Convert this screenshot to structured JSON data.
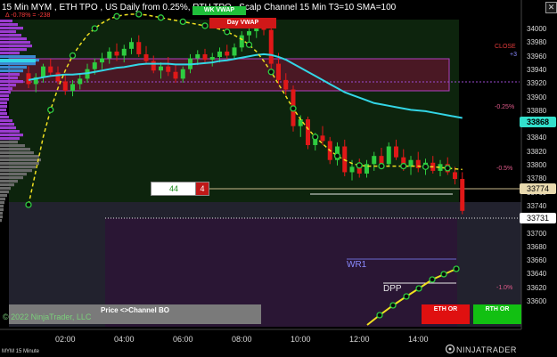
{
  "header": {
    "title": "15 Min MYM , ETH TPO , US Daily from 0.25%, RTH TPO , Scalp Channel 15 Min  T3=10 SMA=100",
    "subtitle": "Δ -0.78% = -238",
    "close_icon": "close-x-icon"
  },
  "tags": {
    "wk_vwap": "WK VWAP",
    "day_vwap": "Day VWAP",
    "close": "CLOSE",
    "close_sub": "+3"
  },
  "percent_labels": [
    "-0.25%",
    "-0.5%",
    "-1.0%"
  ],
  "price_axis": {
    "ticks": [
      "34000",
      "33980",
      "33960",
      "33940",
      "33920",
      "33900",
      "33880",
      "33860",
      "33840",
      "33820",
      "33800",
      "33780",
      "33760",
      "33740",
      "33720",
      "33700",
      "33680",
      "33660",
      "33640",
      "33620",
      "33600"
    ],
    "highlight_current": "33868",
    "highlight_level": "33774",
    "highlight_last": "33731"
  },
  "time_axis": [
    "02:00",
    "04:00",
    "06:00",
    "08:00",
    "10:00",
    "12:00",
    "14:00"
  ],
  "labels": {
    "wr1": "WR1",
    "dpp": "DPP",
    "price_channel": "Price <>Channel BO",
    "copyright": "© 2022 NinjaTrader, LLC",
    "counter_green": "44",
    "counter_red": "4",
    "eth_button": "ETH OR",
    "rth_button": "RTH OR",
    "brand": "NINJATRADER",
    "bottom_tab": "MYM 15 Minute"
  },
  "colors": {
    "background": "#000000",
    "bull_candle": "#2ecc40",
    "bear_candle": "#e01818",
    "sma_line": "#33d6e6",
    "channel_dots": "#f0e020",
    "pink_zone": "#5a1e2a",
    "grey_zone": "#2a2a3a",
    "purple_zone": "#2a1a34",
    "green_zone": "#0d2a0d"
  },
  "candles": [
    {
      "t": "00:15",
      "o": 33934,
      "h": 33944,
      "l": 33912,
      "c": 33918
    },
    {
      "t": "00:30",
      "o": 33918,
      "h": 33934,
      "l": 33906,
      "c": 33928
    },
    {
      "t": "00:45",
      "o": 33928,
      "h": 33948,
      "l": 33920,
      "c": 33944
    },
    {
      "t": "01:00",
      "o": 33944,
      "h": 33955,
      "l": 33930,
      "c": 33935
    },
    {
      "t": "01:15",
      "o": 33935,
      "h": 33944,
      "l": 33918,
      "c": 33922
    },
    {
      "t": "01:30",
      "o": 33922,
      "h": 33932,
      "l": 33902,
      "c": 33908
    },
    {
      "t": "01:45",
      "o": 33908,
      "h": 33924,
      "l": 33900,
      "c": 33918
    },
    {
      "t": "02:00",
      "o": 33918,
      "h": 33932,
      "l": 33910,
      "c": 33926
    },
    {
      "t": "02:15",
      "o": 33926,
      "h": 33948,
      "l": 33920,
      "c": 33940
    },
    {
      "t": "02:30",
      "o": 33940,
      "h": 33956,
      "l": 33932,
      "c": 33950
    },
    {
      "t": "02:45",
      "o": 33950,
      "h": 33964,
      "l": 33940,
      "c": 33956
    },
    {
      "t": "03:00",
      "o": 33956,
      "h": 33972,
      "l": 33948,
      "c": 33966
    },
    {
      "t": "03:15",
      "o": 33966,
      "h": 33978,
      "l": 33952,
      "c": 33960
    },
    {
      "t": "03:30",
      "o": 33960,
      "h": 33976,
      "l": 33950,
      "c": 33970
    },
    {
      "t": "03:45",
      "o": 33970,
      "h": 33986,
      "l": 33962,
      "c": 33980
    },
    {
      "t": "04:00",
      "o": 33980,
      "h": 33990,
      "l": 33958,
      "c": 33962
    },
    {
      "t": "04:15",
      "o": 33962,
      "h": 33974,
      "l": 33948,
      "c": 33952
    },
    {
      "t": "04:30",
      "o": 33952,
      "h": 33960,
      "l": 33934,
      "c": 33938
    },
    {
      "t": "04:45",
      "o": 33938,
      "h": 33950,
      "l": 33926,
      "c": 33944
    },
    {
      "t": "05:00",
      "o": 33944,
      "h": 33958,
      "l": 33930,
      "c": 33936
    },
    {
      "t": "05:15",
      "o": 33936,
      "h": 33946,
      "l": 33920,
      "c": 33926
    },
    {
      "t": "05:30",
      "o": 33926,
      "h": 33944,
      "l": 33920,
      "c": 33940
    },
    {
      "t": "05:45",
      "o": 33940,
      "h": 33962,
      "l": 33934,
      "c": 33956
    },
    {
      "t": "06:00",
      "o": 33956,
      "h": 33968,
      "l": 33946,
      "c": 33962
    },
    {
      "t": "06:15",
      "o": 33962,
      "h": 33970,
      "l": 33950,
      "c": 33954
    },
    {
      "t": "06:30",
      "o": 33954,
      "h": 33964,
      "l": 33944,
      "c": 33958
    },
    {
      "t": "06:45",
      "o": 33958,
      "h": 33972,
      "l": 33950,
      "c": 33966
    },
    {
      "t": "07:00",
      "o": 33966,
      "h": 33976,
      "l": 33954,
      "c": 33960
    },
    {
      "t": "07:15",
      "o": 33960,
      "h": 33978,
      "l": 33956,
      "c": 33972
    },
    {
      "t": "07:30",
      "o": 33972,
      "h": 33996,
      "l": 33966,
      "c": 33990
    },
    {
      "t": "07:45",
      "o": 33990,
      "h": 34004,
      "l": 33980,
      "c": 33996
    },
    {
      "t": "08:00",
      "o": 33996,
      "h": 34010,
      "l": 33986,
      "c": 34002
    },
    {
      "t": "08:15",
      "o": 34002,
      "h": 34014,
      "l": 33990,
      "c": 33998
    },
    {
      "t": "08:30",
      "o": 33998,
      "h": 34012,
      "l": 33940,
      "c": 33948
    },
    {
      "t": "08:45",
      "o": 33948,
      "h": 33964,
      "l": 33918,
      "c": 33924
    },
    {
      "t": "09:00",
      "o": 33924,
      "h": 33934,
      "l": 33902,
      "c": 33910
    },
    {
      "t": "09:15",
      "o": 33910,
      "h": 33916,
      "l": 33848,
      "c": 33856
    },
    {
      "t": "09:30",
      "o": 33856,
      "h": 33872,
      "l": 33840,
      "c": 33866
    },
    {
      "t": "09:45",
      "o": 33866,
      "h": 33870,
      "l": 33822,
      "c": 33828
    },
    {
      "t": "10:00",
      "o": 33828,
      "h": 33846,
      "l": 33820,
      "c": 33842
    },
    {
      "t": "10:15",
      "o": 33842,
      "h": 33856,
      "l": 33828,
      "c": 33834
    },
    {
      "t": "10:30",
      "o": 33834,
      "h": 33840,
      "l": 33800,
      "c": 33806
    },
    {
      "t": "10:45",
      "o": 33806,
      "h": 33832,
      "l": 33798,
      "c": 33826
    },
    {
      "t": "11:00",
      "o": 33826,
      "h": 33836,
      "l": 33782,
      "c": 33788
    },
    {
      "t": "11:15",
      "o": 33788,
      "h": 33806,
      "l": 33776,
      "c": 33796
    },
    {
      "t": "11:30",
      "o": 33796,
      "h": 33808,
      "l": 33780,
      "c": 33786
    },
    {
      "t": "11:45",
      "o": 33786,
      "h": 33806,
      "l": 33780,
      "c": 33800
    },
    {
      "t": "12:00",
      "o": 33800,
      "h": 33818,
      "l": 33790,
      "c": 33812
    },
    {
      "t": "12:15",
      "o": 33812,
      "h": 33824,
      "l": 33794,
      "c": 33800
    },
    {
      "t": "12:30",
      "o": 33800,
      "h": 33832,
      "l": 33796,
      "c": 33826
    },
    {
      "t": "12:45",
      "o": 33826,
      "h": 33836,
      "l": 33806,
      "c": 33810
    },
    {
      "t": "13:00",
      "o": 33810,
      "h": 33822,
      "l": 33790,
      "c": 33796
    },
    {
      "t": "13:15",
      "o": 33796,
      "h": 33812,
      "l": 33784,
      "c": 33806
    },
    {
      "t": "13:30",
      "o": 33806,
      "h": 33818,
      "l": 33788,
      "c": 33794
    },
    {
      "t": "13:45",
      "o": 33794,
      "h": 33808,
      "l": 33784,
      "c": 33802
    },
    {
      "t": "14:00",
      "o": 33802,
      "h": 33812,
      "l": 33786,
      "c": 33790
    },
    {
      "t": "14:15",
      "o": 33790,
      "h": 33806,
      "l": 33782,
      "c": 33800
    },
    {
      "t": "14:30",
      "o": 33800,
      "h": 33810,
      "l": 33784,
      "c": 33788
    },
    {
      "t": "14:45",
      "o": 33788,
      "h": 33796,
      "l": 33770,
      "c": 33778
    },
    {
      "t": "15:00",
      "o": 33778,
      "h": 33788,
      "l": 33726,
      "c": 33731
    }
  ],
  "sma": [
    33924,
    33926,
    33928,
    33930,
    33931,
    33932,
    33932,
    33933,
    33934,
    33936,
    33938,
    33940,
    33942,
    33943,
    33945,
    33947,
    33948,
    33948,
    33948,
    33948,
    33947,
    33947,
    33947,
    33948,
    33949,
    33950,
    33952,
    33953,
    33955,
    33957,
    33959,
    33961,
    33962,
    33961,
    33958,
    33954,
    33948,
    33942,
    33936,
    33930,
    33924,
    33918,
    33912,
    33906,
    33902,
    33898,
    33894,
    33890,
    33888,
    33886,
    33884,
    33882,
    33880,
    33879,
    33878,
    33876,
    33874,
    33872,
    33870,
    33868
  ],
  "channel_upper": [
    33740,
    33790,
    33840,
    33880,
    33912,
    33938,
    33960,
    33976,
    33990,
    34000,
    34008,
    34014,
    34018,
    34020,
    34021,
    34021,
    34020,
    34018,
    34016,
    34014,
    34012,
    34010,
    34008,
    34006,
    34004,
    34002,
    33999,
    33995,
    33990,
    33984,
    33976,
    33966,
    33952,
    33936,
    33918,
    33900,
    33882,
    33866,
    33852,
    33840,
    33830,
    33820,
    33812,
    33806,
    33801,
    33798,
    33797,
    33797,
    33797,
    33797,
    33797,
    33797,
    33797,
    33797,
    33796,
    33796,
    33795,
    33794,
    33793,
    33792
  ],
  "channel_lower": [
    33598,
    33606,
    33616,
    33626,
    33636,
    33648,
    33660
  ]
}
